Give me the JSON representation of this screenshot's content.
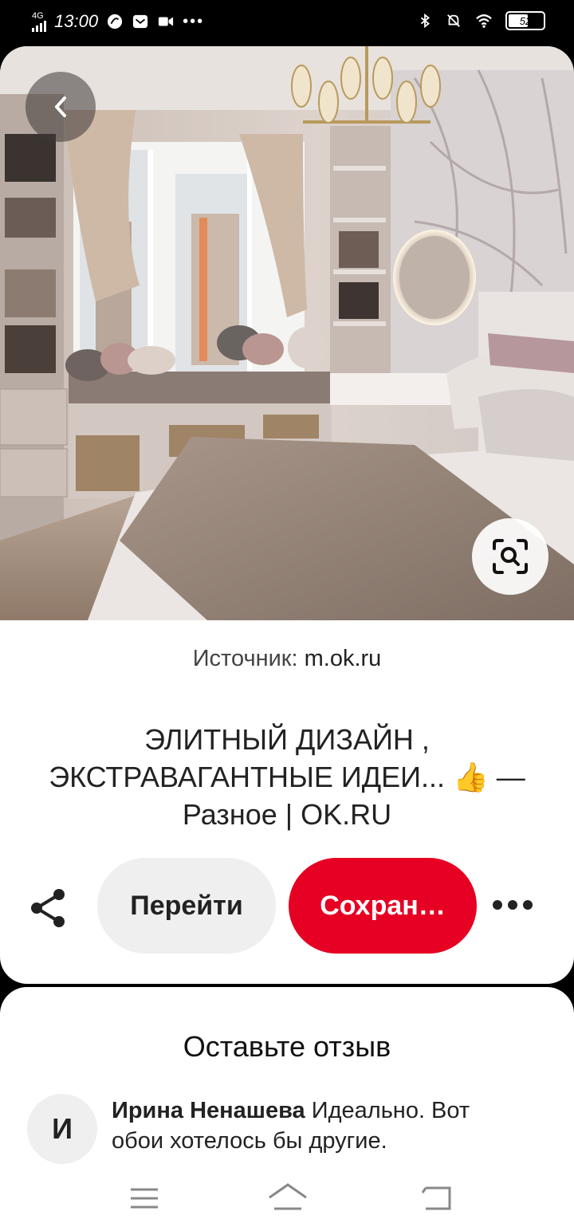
{
  "status_bar": {
    "network": "4G",
    "time": "13:00",
    "battery": "52"
  },
  "image": {
    "description_icon_back": "chevron-left-icon",
    "visual_search_icon": "lens-search-icon"
  },
  "source": {
    "label": "Источник:",
    "domain": "m.ok.ru"
  },
  "pin": {
    "title": "ЭЛИТНЫЙ ДИЗАЙН , ЭКСТРАВАГАНТНЫЕ ИДЕИ... 👍 — Разное | OK.RU"
  },
  "actions": {
    "visit_label": "Перейти",
    "save_label": "Сохран…",
    "save_color": "#e60023"
  },
  "reviews": {
    "heading": "Оставьте отзыв",
    "comments": [
      {
        "avatar_letter": "И",
        "author": "Ирина Ненашева",
        "text": "Идеально. Вот обои хотелось бы другие."
      }
    ]
  }
}
